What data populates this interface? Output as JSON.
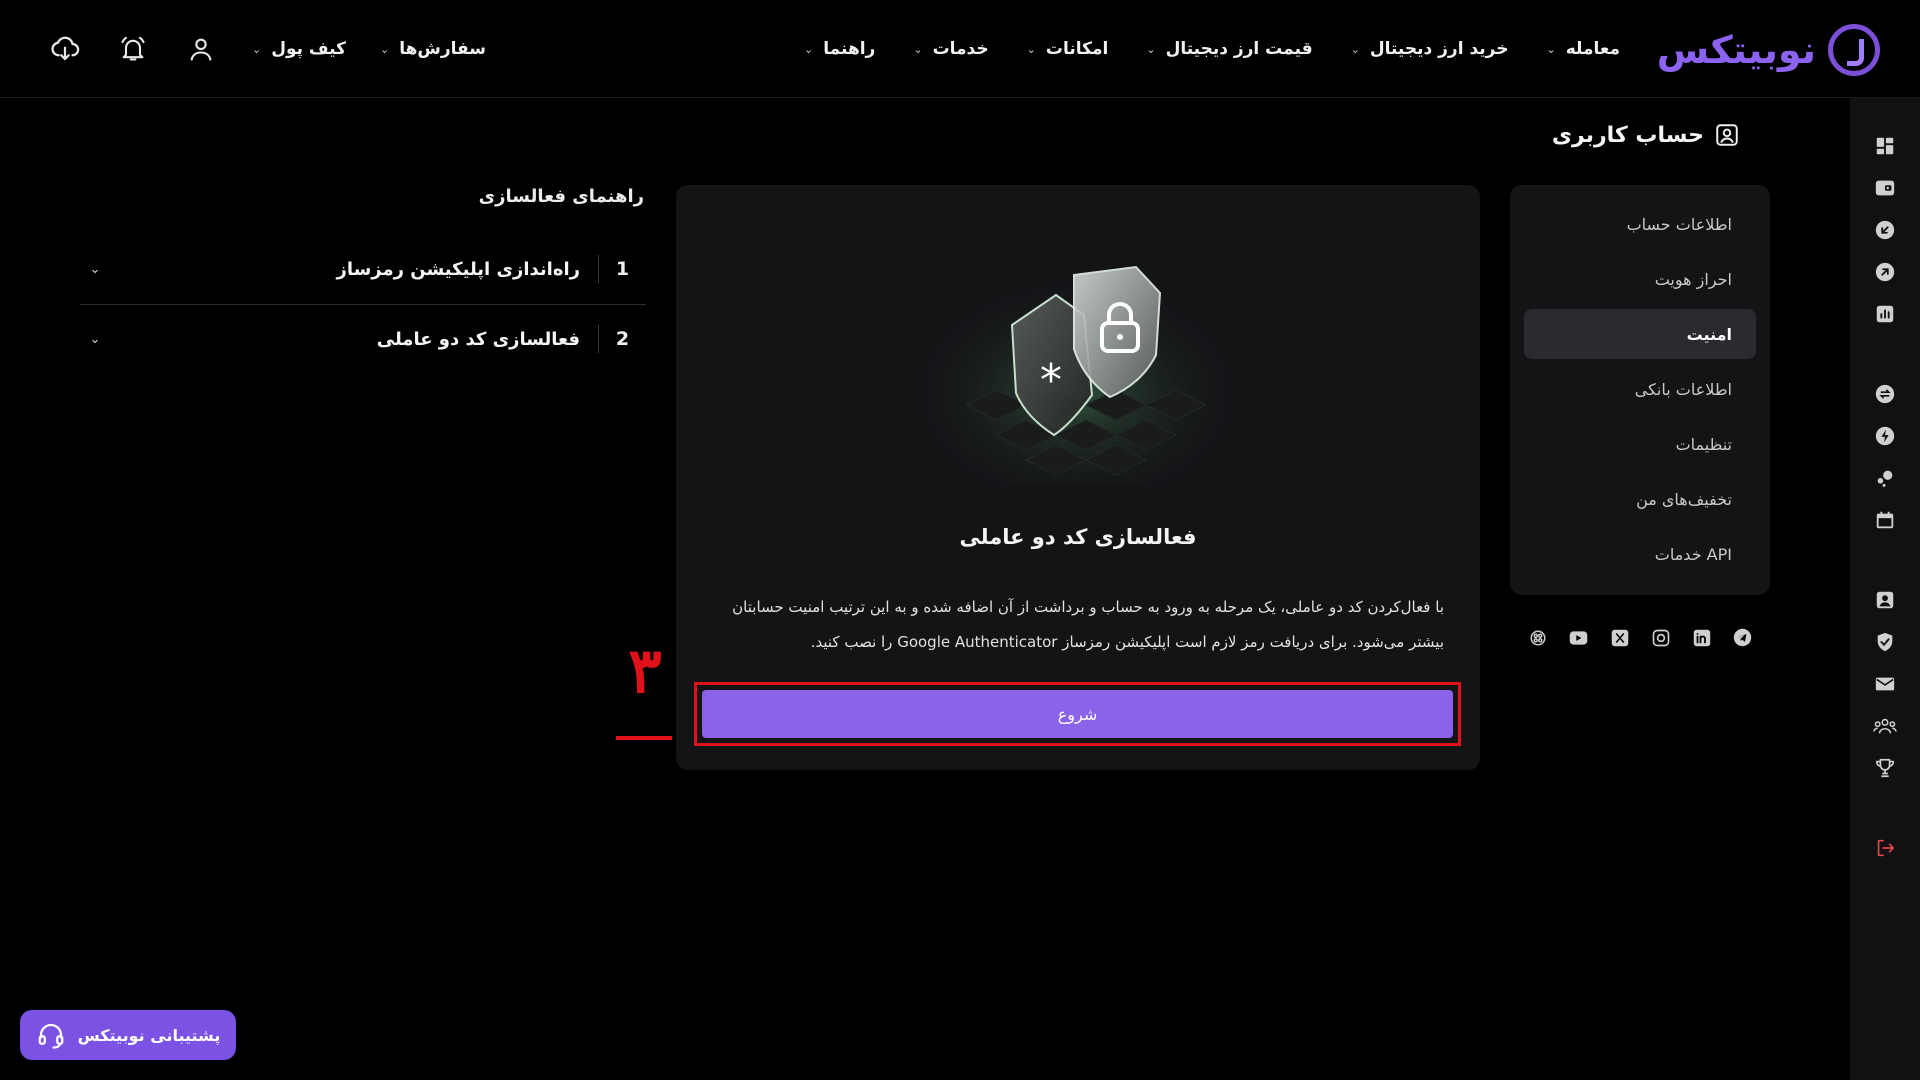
{
  "brand": {
    "name": "نوبیتکس"
  },
  "nav": {
    "items": [
      {
        "label": "معامله"
      },
      {
        "label": "خرید ارز دیجیتال"
      },
      {
        "label": "قیمت ارز دیجیتال"
      },
      {
        "label": "امکانات"
      },
      {
        "label": "خدمات"
      },
      {
        "label": "راهنما"
      }
    ]
  },
  "top_left": {
    "orders_label": "سفارش‌ها",
    "wallet_label": "کیف پول"
  },
  "page": {
    "title": "حساب کاربری"
  },
  "account_menu": {
    "items": [
      {
        "label": "اطلاعات حساب"
      },
      {
        "label": "احراز هویت"
      },
      {
        "label": "امنیت"
      },
      {
        "label": "اطلاعات بانکی"
      },
      {
        "label": "تنظیمات"
      },
      {
        "label": "تخفیف‌های من"
      },
      {
        "label": "خدمات API"
      }
    ],
    "active_index": 2
  },
  "card": {
    "title": "فعالسازی کد دو عاملی",
    "description": "با فعال‌کردن کد دو عاملی، یک مرحله به ورود به حساب و برداشت از آن اضافه شده و به این ترتیب امنیت حسابتان بیشتر می‌شود. برای دریافت رمز لازم است اپلیکیشن رمزساز Google Authenticator را نصب کنید.",
    "start_label": "شروع"
  },
  "annotation": {
    "step_marker": "۳"
  },
  "guide": {
    "title": "راهنمای فعالسازی",
    "steps": [
      {
        "num": "1",
        "label": "راه‌اندازی اپلیکیشن رمزساز"
      },
      {
        "num": "2",
        "label": "فعالسازی کد دو عاملی"
      }
    ]
  },
  "support": {
    "label": "پشتیبانی نوبیتکس"
  },
  "colors": {
    "accent": "#8b62ea",
    "highlight_box": "#e1111a",
    "card_bg": "#141417",
    "page_bg": "#000000"
  },
  "icons": {
    "top_left": [
      "download-app-icon",
      "bell-icon",
      "user-icon"
    ],
    "rail": [
      "dashboard-icon",
      "wallet-icon",
      "deposit-icon",
      "withdraw-icon",
      "chart-icon",
      "convert-icon",
      "lightning-icon",
      "staking-icon",
      "calendar-icon",
      "profile-icon",
      "shield-icon",
      "mail-icon",
      "referral-icon",
      "trophy-icon",
      "logout-icon"
    ],
    "socials": [
      "telegram-icon",
      "linkedin-icon",
      "instagram-icon",
      "x-icon",
      "youtube-icon",
      "aparat-icon"
    ]
  }
}
